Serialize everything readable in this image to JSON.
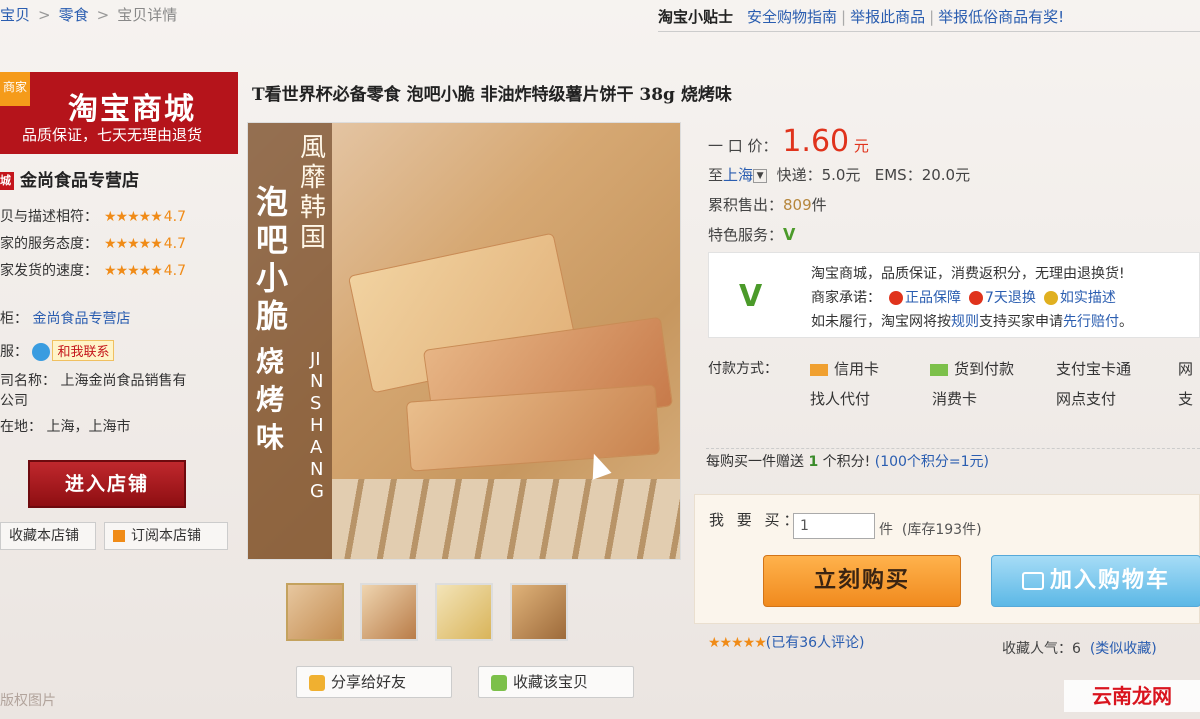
{
  "breadcrumb": {
    "items": [
      "宝贝",
      "零食",
      "宝贝详情"
    ],
    "separator": ">"
  },
  "tips": {
    "title": "淘宝小贴士",
    "links": [
      "安全购物指南",
      "举报此商品",
      "举报低俗商品有奖!"
    ]
  },
  "store": {
    "ribbon": "商家",
    "mall_name": "淘宝商城",
    "mall_slogan": "品质保证，七天无理由退货",
    "badge": "城",
    "name": "金尚食品专营店",
    "ratings": [
      {
        "label": "贝与描述相符：",
        "stars": "★★★★★",
        "score": "4.7"
      },
      {
        "label": "家的服务态度：",
        "stars": "★★★★★",
        "score": "4.7"
      },
      {
        "label": "家发货的速度：",
        "stars": "★★★★★",
        "score": "4.7"
      }
    ],
    "shop_label": "柜：",
    "shop_value": "金尚食品专营店",
    "contact_label": "服：",
    "contact_value": "和我联系",
    "company_label": "司名称：",
    "company_value_1": "上海金尚食品销售有",
    "company_value_2": "公司",
    "location_label": "在地：",
    "location_value": "上海，上海市",
    "enter_btn": "进入店铺",
    "fav_store": "收藏本店铺",
    "subscribe_store": "订阅本店铺"
  },
  "product": {
    "title": "T看世界杯必备零食 泡吧小脆 非油炸特级薯片饼干 38g 烧烤味",
    "image_text": {
      "brand": "風靡韩国",
      "name": "泡吧小脆",
      "flavor": "烧烤味",
      "jin": "JINSHANG"
    },
    "share_btn": "分享给好友",
    "fav_btn": "收藏该宝贝"
  },
  "price": {
    "label": "一 口 价：",
    "value": "1.60",
    "unit": "元",
    "ship_to_label": "至",
    "ship_to": "上海",
    "express": "快递：5.0元",
    "ems": "EMS：20.0元",
    "sold_label": "累积售出：",
    "sold_value": "809",
    "sold_unit": "件",
    "service_label": "特色服务："
  },
  "guarantee": {
    "line1": "淘宝商城，品质保证，消费返积分，无理由退换货!",
    "promise_label": "商家承诺：",
    "promise_1": "正品保障",
    "promise_2": "7天退换",
    "promise_3": "如实描述",
    "line3_a": "如未履行，淘宝网将按",
    "line3_link1": "规则",
    "line3_b": "支持买家申请",
    "line3_link2": "先行赔付",
    "line3_c": "。"
  },
  "payment": {
    "label": "付款方式：",
    "methods": [
      "信用卡",
      "货到付款",
      "支付宝卡通",
      "网",
      "找人代付",
      "消费卡",
      "网点支付",
      "支"
    ]
  },
  "points": {
    "text_a": "每购买一件赠送",
    "count": "1",
    "text_b": "个积分!",
    "note": "(100个积分=1元)"
  },
  "purchase": {
    "label": "我 要 买：",
    "qty": "1",
    "unit": "件",
    "stock": "(库存193件)",
    "buy_now": "立刻购买",
    "add_cart": "加入购物车"
  },
  "reviews": {
    "stars": "★★★★★",
    "text": "(已有36人评论)",
    "fav_label": "收藏人气：",
    "fav_count": "6",
    "fav_link": "(类似收藏)"
  },
  "watermarks": {
    "left": "版权图片",
    "right": "云南龙网"
  },
  "colors": {
    "price": "#e0331c",
    "mall_red": "#b5141b",
    "link": "#2a5db0",
    "buy": "#f08a1e",
    "cart": "#5cb8e6"
  }
}
